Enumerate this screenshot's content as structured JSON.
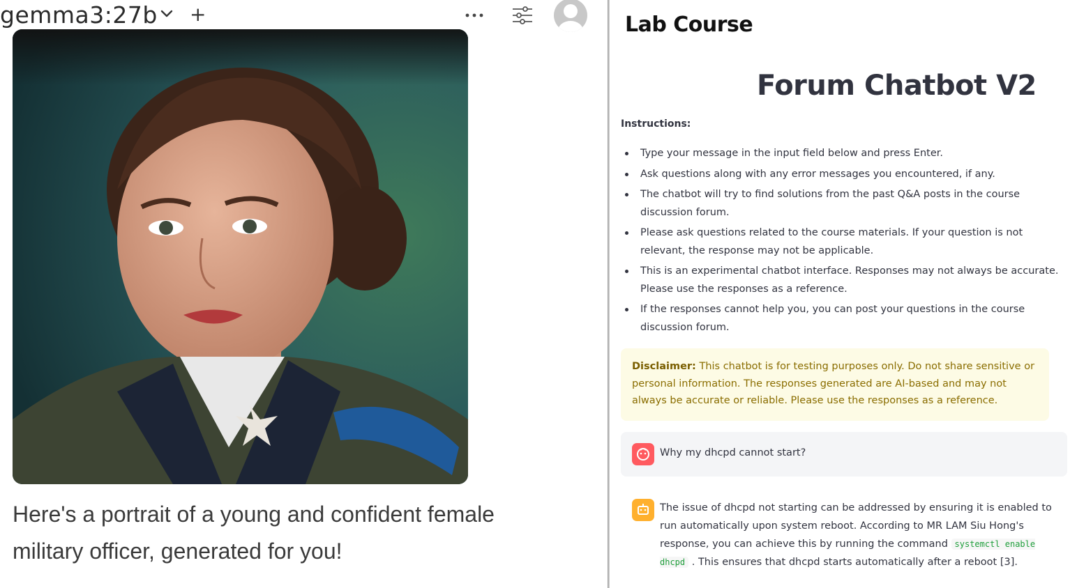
{
  "header": {
    "model_name": "gemma3:27b",
    "new_chat_symbol": "+",
    "icons": [
      "chevron-down-icon",
      "more-dots-icon",
      "settings-sliders-icon",
      "user-avatar-icon"
    ]
  },
  "message": {
    "caption": "Here's a portrait of a young and confident female military officer, generated for you!"
  },
  "app": {
    "title_prefix": "Lab Course",
    "title_main": "Forum Chatbot V2",
    "instructions_heading": "Instructions:",
    "instructions": [
      "Type your message in the input field below and press Enter.",
      "Ask questions along with any error messages you encountered, if any.",
      "The chatbot will try to find solutions from the past Q&A posts in the course discussion forum.",
      "Please ask questions related to the course materials. If your question is not relevant, the response may not be applicable.",
      "This is an experimental chatbot interface. Responses may not always be accurate. Please use the responses as a reference.",
      "If the responses cannot help you, you can post your questions in the course discussion forum."
    ],
    "disclaimer_label": "Disclaimer:",
    "disclaimer_text": " This chatbot is for testing purposes only. Do not share sensitive or personal information. The responses generated are AI-based and may not always be accurate or reliable. Please use the responses as a reference.",
    "user_message": "Why my dhcpd cannot start?",
    "bot_text_1": "The issue of dhcpd not starting can be addressed by ensuring it is enabled to run automatically upon system reboot. According to MR LAM Siu Hong's response, you can achieve this by running the command ",
    "bot_code": "systemctl enable dhcpd",
    "bot_text_2": " . This ensures that dhcpd starts automatically after a reboot [3]."
  },
  "colors": {
    "disclaimer_bg": "#fdfbe5",
    "disclaimer_text": "#8a6d00",
    "user_avatar": "#ff5a5f",
    "bot_avatar": "#ffb02e",
    "code_text": "#1e9e3a"
  }
}
